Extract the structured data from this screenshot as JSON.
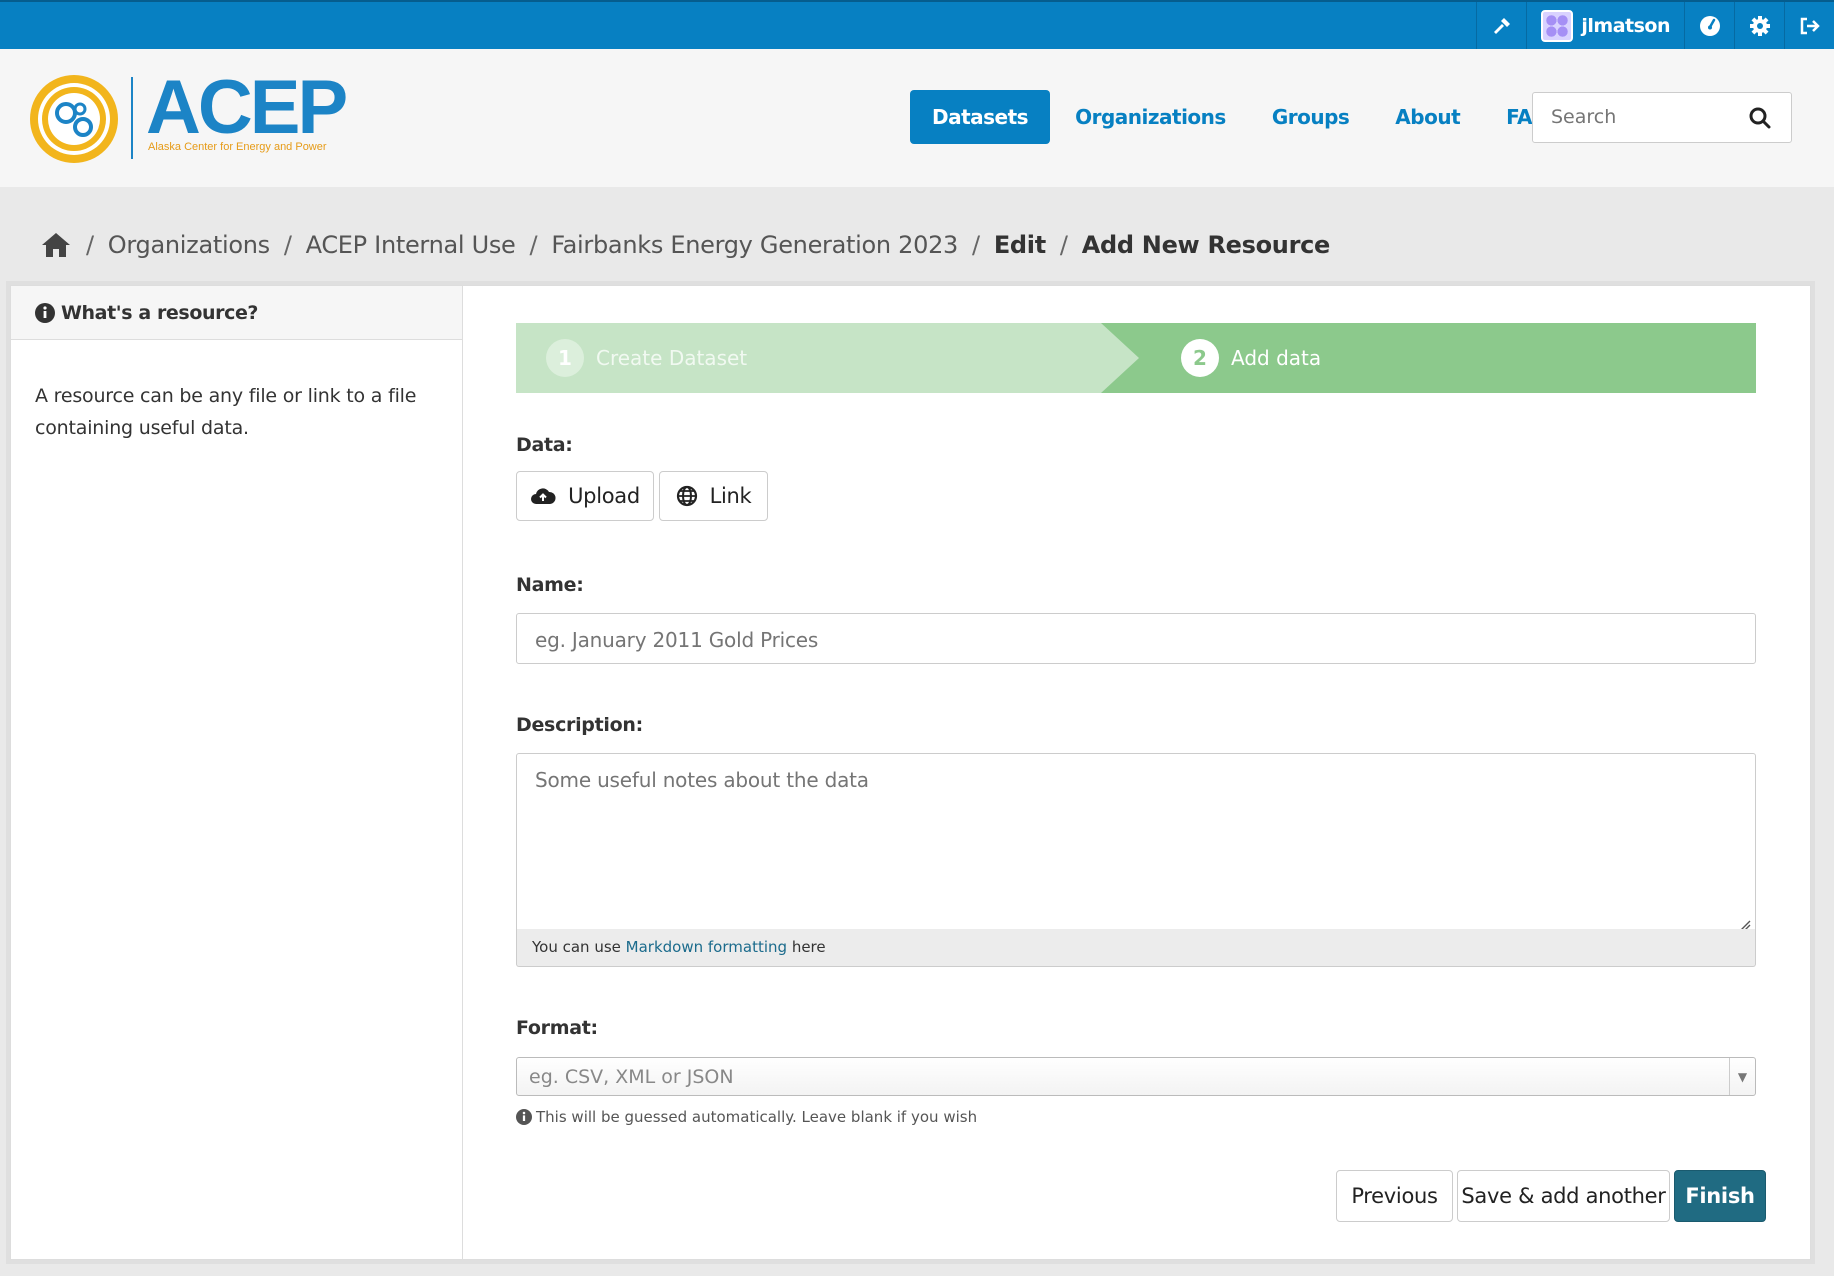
{
  "account": {
    "username": "jlmatson",
    "icons": [
      "sysadmin-hammer-icon",
      "dashboard-icon",
      "settings-gear-icon",
      "logout-icon"
    ]
  },
  "logo": {
    "name": "ACEP",
    "tagline": "Alaska Center for Energy and Power"
  },
  "nav": {
    "items": [
      {
        "label": "Datasets",
        "active": true
      },
      {
        "label": "Organizations",
        "active": false
      },
      {
        "label": "Groups",
        "active": false
      },
      {
        "label": "About",
        "active": false
      },
      {
        "label": "FAQ",
        "active": false
      }
    ],
    "search_placeholder": "Search"
  },
  "breadcrumb": {
    "items": [
      "Organizations",
      "ACEP Internal Use",
      "Fairbanks Energy Generation 2023",
      "Edit",
      "Add New Resource"
    ]
  },
  "sidebar": {
    "title": "What's a resource?",
    "body": "A resource can be any file or link to a file containing useful data."
  },
  "stages": [
    {
      "number": "1",
      "label": "Create Dataset",
      "state": "complete"
    },
    {
      "number": "2",
      "label": "Add data",
      "state": "active"
    }
  ],
  "form": {
    "data_label": "Data:",
    "upload_label": "Upload",
    "link_label": "Link",
    "name_label": "Name:",
    "name_placeholder": "eg. January 2011 Gold Prices",
    "description_label": "Description:",
    "description_placeholder": "Some useful notes about the data",
    "markdown_prefix": "You can use",
    "markdown_link": "Markdown formatting",
    "markdown_suffix": "here",
    "format_label": "Format:",
    "format_placeholder": "eg. CSV, XML or JSON",
    "format_help": "This will be guessed automatically. Leave blank if you wish",
    "previous_label": "Previous",
    "save_another_label": "Save & add another",
    "finish_label": "Finish"
  },
  "colors": {
    "primary": "#0780c2",
    "stage_complete": "#c6e4c6",
    "stage_active": "#8cc98c",
    "finish_button": "#206b82"
  }
}
